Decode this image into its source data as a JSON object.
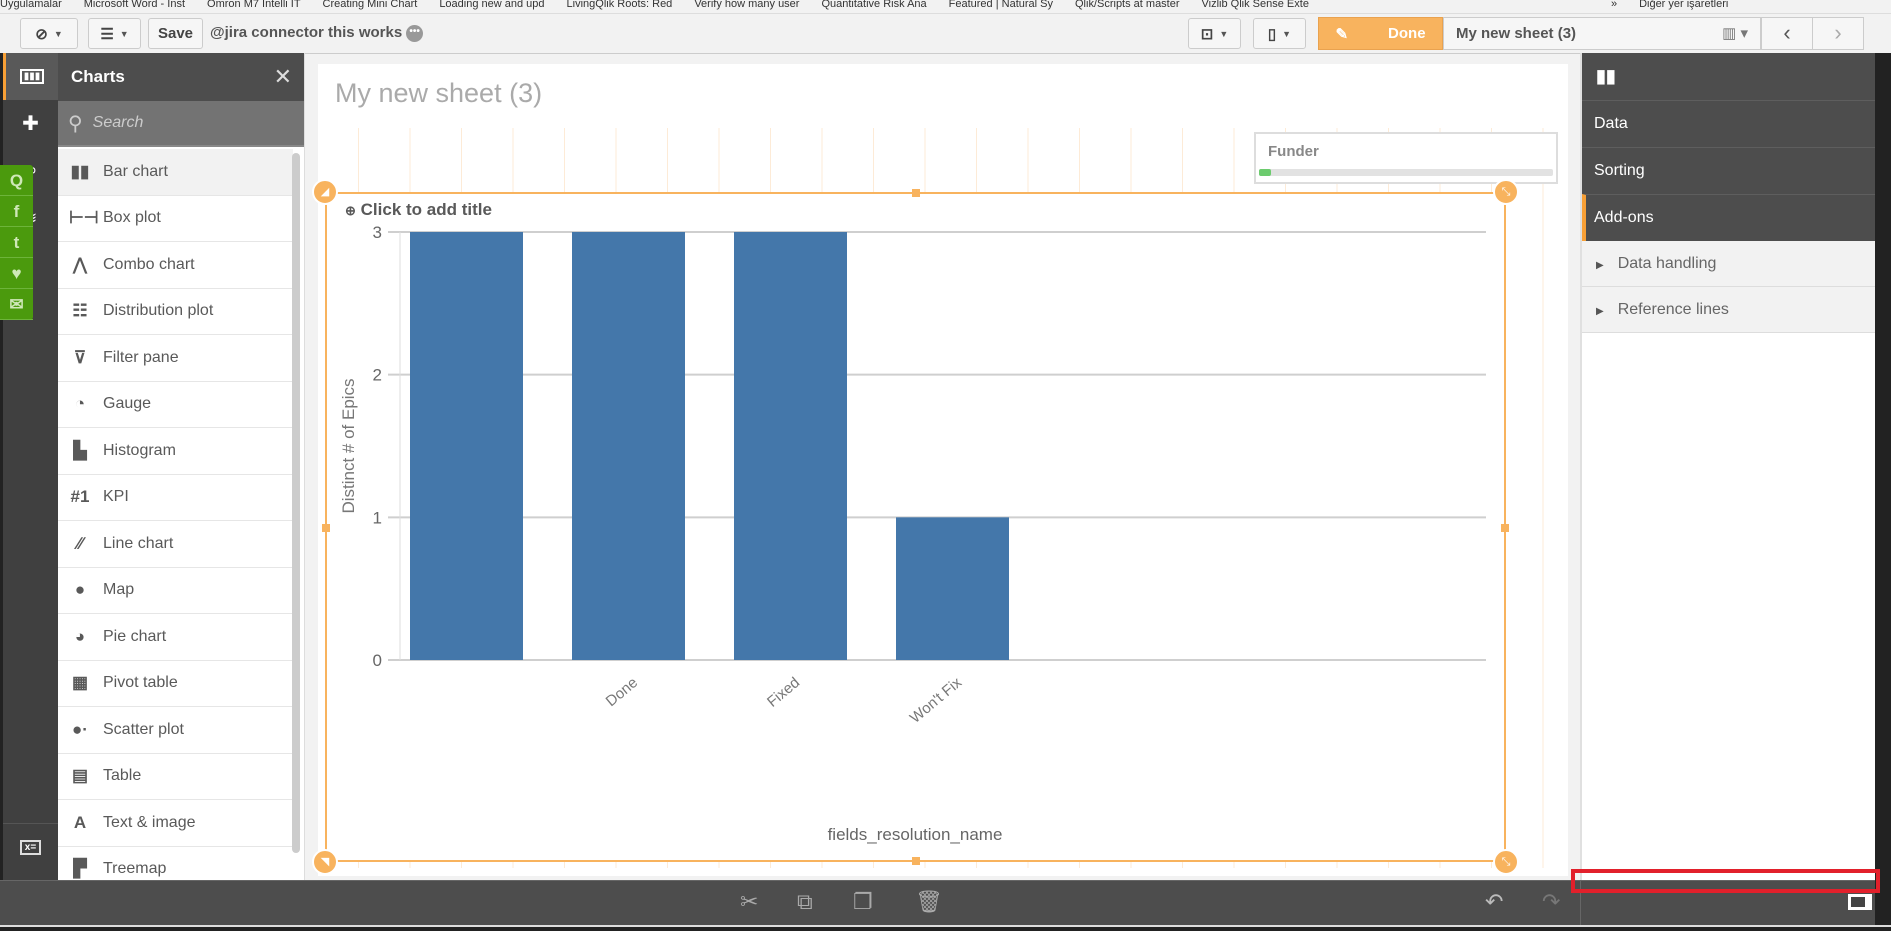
{
  "browser": {
    "bookmarks": [
      "Uygulamalar",
      "Microsoft Word - Inst",
      "Omron M7 Intelli IT",
      "Creating Mini Chart",
      "Loading new and upd",
      "LivingQlik Roots: Red",
      "Verify how many user",
      "Quantitative Risk Ana",
      "Featured | Natural Sy",
      "Qlik/Scripts at master",
      "Vizlib Qlik Sense Exte"
    ],
    "overflow": "»",
    "other_bookmarks": "Diğer yer işaretleri"
  },
  "toolbar": {
    "save_label": "Save",
    "app_title": "@jira connector this works",
    "done_label": "Done",
    "sheet_name": "My new sheet (3)",
    "prev": "‹",
    "next": "›"
  },
  "assets": {
    "title": "Charts",
    "close": "✕",
    "search_placeholder": "Search",
    "items": [
      {
        "icon": "▮▮",
        "label": "Bar chart"
      },
      {
        "icon": "⊢⊣",
        "label": "Box plot"
      },
      {
        "icon": "⋀",
        "label": "Combo chart"
      },
      {
        "icon": "☷",
        "label": "Distribution plot"
      },
      {
        "icon": "⊽",
        "label": "Filter pane"
      },
      {
        "icon": "◔",
        "label": "Gauge"
      },
      {
        "icon": "▙",
        "label": "Histogram"
      },
      {
        "icon": "#1",
        "label": "KPI"
      },
      {
        "icon": "∕∕",
        "label": "Line chart"
      },
      {
        "icon": "●",
        "label": "Map"
      },
      {
        "icon": "◕",
        "label": "Pie chart"
      },
      {
        "icon": "▦",
        "label": "Pivot table"
      },
      {
        "icon": "●·",
        "label": "Scatter plot"
      },
      {
        "icon": "▤",
        "label": "Table"
      },
      {
        "icon": "A",
        "label": "Text & image"
      },
      {
        "icon": "▛",
        "label": "Treemap"
      }
    ]
  },
  "social": [
    "Q",
    "f",
    "t",
    "♥",
    "✉"
  ],
  "sheet": {
    "title": "My new sheet (3)",
    "filter": {
      "label": "Funder",
      "progress": 0.04
    },
    "chart_title_placeholder": "Click to add title"
  },
  "chart_data": {
    "type": "bar",
    "title": "",
    "categories": [
      "",
      "Done",
      "Fixed",
      "Won't Fix"
    ],
    "values": [
      3,
      3,
      3,
      1
    ],
    "xlabel": "fields_resolution_name",
    "ylabel": "Distinct # of Epics",
    "ylim": [
      0,
      3
    ],
    "yticks": [
      "0",
      "1",
      "2",
      "3"
    ],
    "grid": true,
    "color": "#4477aa"
  },
  "properties": {
    "tabs": [
      "Data",
      "Sorting",
      "Add-ons"
    ],
    "active_tab": "Add-ons",
    "sections": [
      "Data handling",
      "Reference lines"
    ]
  },
  "colors": {
    "accent": "#f8b35e",
    "bar": "#4477aa",
    "dark": "#4d4d4d"
  }
}
